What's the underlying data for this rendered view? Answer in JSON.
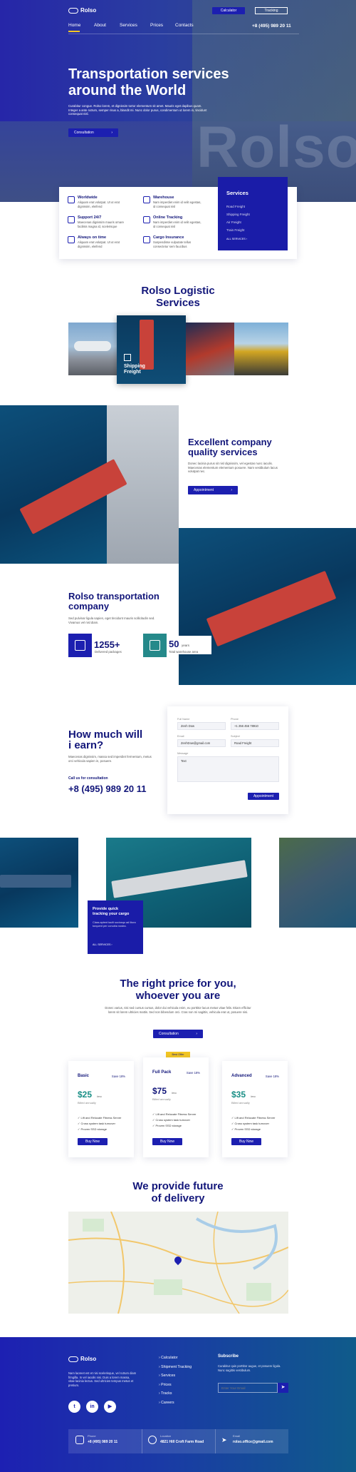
{
  "nav": {
    "logo": "Rolso",
    "items": [
      "Home",
      "About",
      "Services",
      "Prices",
      "Contacts"
    ],
    "calculator": "Calculator",
    "tracking": "Tracking",
    "phone": "+8 (495) 989 20 11"
  },
  "hero": {
    "title_line1": "Transportation services",
    "title_line2": "around the World",
    "text": "Curabitur congue. Rolso lorem, et dignissim tortor elementum sit amet. Mauris eget dapibus quam. Integer a ante rutrum, semper risus a, blandit mi. Nunc dolor purus, condimentum ut lorem in, tincidunt consequat nisl.",
    "cta": "Consultation",
    "bg_word": "Rolso"
  },
  "features": [
    {
      "title": "Worldwide",
      "text": "Aliquam erat volutpat. Ut ut erat dignissim, eleifend"
    },
    {
      "title": "Warehouse",
      "text": "Nam imperdiet enim id velit egestas, id consequat nisl"
    },
    {
      "title": "Support 24/7",
      "text": "Maecenas dignissim mauris ornare facilisis magna id, scelerisque"
    },
    {
      "title": "Online Tracking",
      "text": "Nam imperdiet enim id velit egestas, id consequat nisl"
    },
    {
      "title": "Always on time",
      "text": "Aliquam erat volutpat. Ut ut erat dignissim, eleifend"
    },
    {
      "title": "Cargo Insurance",
      "text": "Suspendisse vulputate tellus consectetur sem faucibus"
    }
  ],
  "services_box": {
    "title": "Services",
    "items": [
      "Road Freight",
      "Shipping Freight",
      "Air Freight",
      "Train Freight"
    ],
    "more": "ALL SERVICES"
  },
  "logistic": {
    "title_line1": "Rolso Logistic",
    "title_line2": "Services",
    "featured_label_line1": "Shipping",
    "featured_label_line2": "Freight"
  },
  "quality": {
    "title_line1": "Excellent company",
    "title_line2": "quality services",
    "text": "Donec lacinia purus sit nisl dignissim, vel egestas nunc iaculis. Maecenas elementum elementum posuere. Nam vestibulum lacus volutpat nec.",
    "cta": "Appointment"
  },
  "company": {
    "title_line1": "Rolso transportation",
    "title_line2": "company",
    "text": "Sed pulvinar ligula sapien, eget tincidunt mauris sollicitudin sed. Vivamus vel nisl diam.",
    "stat1_value": "1255+",
    "stat1_label": "Delivered packages",
    "stat2_value": "50",
    "stat2_unit": "years",
    "stat2_label": "Total warehouse area"
  },
  "earn": {
    "title_line1": "How much will",
    "title_line2": "i earn?",
    "text": "Maecenas dignissim, massa sed imperdiet fermentum, metus orci vehicula sapien in, posuere.",
    "call_label": "Call us for consultation",
    "phone": "+8 (495) 989 20 11"
  },
  "form": {
    "full_name_label": "Full Name",
    "full_name_value": "Zenh Dow",
    "phone_label": "Phone",
    "phone_value": "+1 256 456 78910",
    "email_label": "Email",
    "email_value": "ZenhDow@gmail.com",
    "subject_label": "Subject",
    "subject_value": "Road Freight",
    "message_label": "Message",
    "message_value": "Text",
    "submit": "Appointment"
  },
  "tracking_card": {
    "title_line1": "Provide quick",
    "title_line2": "tracking your cargo",
    "text": "Class aptent taciti sociosqu ad litora torquent per conubia nostra.",
    "more": "ALL SERVICES"
  },
  "pricing": {
    "title_line1": "The right price for you,",
    "title_line2": "whoever you are",
    "text": "Donec varius, nisi sed cursus cursus, dolor dui vehicula enim, eu porttitor lacus metus vitae felis. Etiam efficitur lorem sit lorem ultricies mattis. Sed non bibendum orci. Cras non mi sagittis, vehicula erat ut, posuere nisi.",
    "cta": "Consultation",
    "badge": "Best Offer",
    "plans": [
      {
        "name": "Basic",
        "save": "Save 18%",
        "price": "$25",
        "period": "/mo",
        "sub": "Billed annually",
        "features": [
          "Lift and Relocate Fitness Server",
          "Cross system task turnover",
          "Proven SSD storage"
        ],
        "button": "Buy Now"
      },
      {
        "name": "Full Pack",
        "save": "Save 18%",
        "price": "$75",
        "period": "/mo",
        "sub": "Billed annually",
        "features": [
          "Lift and Relocate Fitness Server",
          "Cross system task turnover",
          "Proven SSD storage"
        ],
        "button": "Buy Now"
      },
      {
        "name": "Advanced",
        "save": "Save 18%",
        "price": "$35",
        "period": "/mo",
        "sub": "Billed annually",
        "features": [
          "Lift and Relocate Fitness Server",
          "Cross system task turnover",
          "Proven SSD storage"
        ],
        "button": "Buy Now"
      }
    ]
  },
  "delivery": {
    "title_line1": "We provide future",
    "title_line2": "of delivery"
  },
  "footer": {
    "logo": "Rolso",
    "text": "Nam laoreet est et nisi scelerisque, vel rutrum diam fringilla. In vel iaculis nisi. Duis a lorem massa, vitae lacinia lectus. Sed ultricies tempus metus et pretium.",
    "links": [
      "Calculator",
      "Shipment Tracking",
      "Services",
      "Prices",
      "Tracks",
      "Careers"
    ],
    "subscribe_title": "Subscribe",
    "subscribe_text": "Curabitur quis porttitor augue, et posuere ligula. Nunc sagittis vestibulum.",
    "email_placeholder": "Enter Your Email",
    "contact_phone_label": "Phone",
    "contact_phone": "+8 (495) 989 20 11",
    "contact_location_label": "Location",
    "contact_location": "4821 Hill Croft Farm Road",
    "contact_email_label": "Email",
    "contact_email": "rolso.office@gmail.com"
  }
}
